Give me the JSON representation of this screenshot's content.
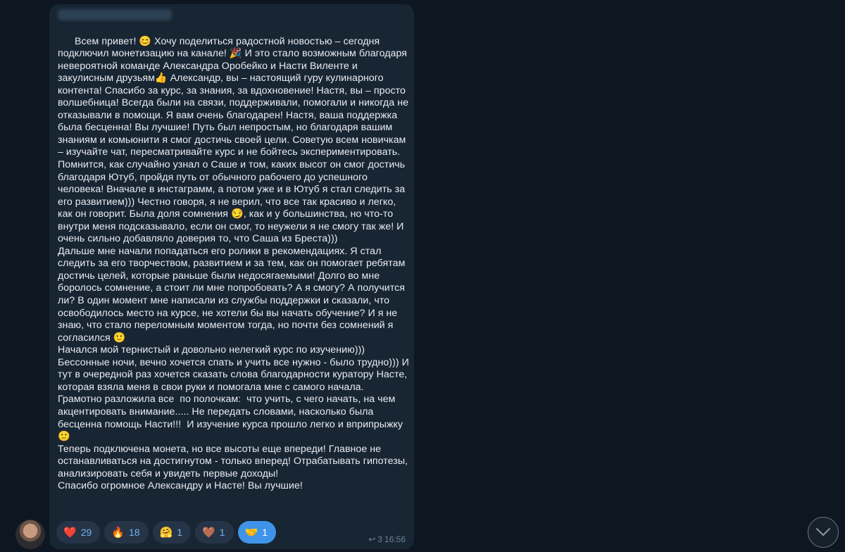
{
  "message": {
    "paragraphs": [
      "Всем привет! 😊 Хочу поделиться радостной новостью – сегодня подключил монетизацию на канале! 🎉 И это стало возможным благодаря невероятной команде Александра Оробейко и Насти Виленте и закулисным друзьям👍 Александр, вы – настоящий гуру кулинарного контента! Спасибо за курс, за знания, за вдохновение! Настя, вы – просто волшебница! Всегда были на связи, поддерживали, помогали и никогда не отказывали в помощи. Я вам очень благодарен! Настя, ваша поддержка была бесценна! Вы лучшие! Путь был непростым, но благодаря вашим знаниям и комьюнити я смог достичь своей цели. Советую всем новичкам – изучайте чат, пересматривайте курс и не бойтесь экспериментировать.",
      "Помнится, как случайно узнал о Саше и том, каких высот он смог достичь благодаря Ютуб, пройдя путь от обычного рабочего до успешного человека! Вначале в инстаграмм, а потом уже и в Ютуб я стал следить за его развитием))) Честно говоря, я не верил, что все так красиво и легко, как он говорит. Была доля сомнения 😏, как и у большинства, но что-то внутри меня подсказывало, если он смог, то неужели я не смогу так же! И очень сильно добавляло доверия то, что Саша из Бреста)))",
      "Дальше мне начали попадаться его ролики в рекомендациях. Я стал следить за его творчеством, развитием и за тем, как он помогает ребятам достичь целей, которые раньше были недосягаемыми! Долго во мне боролось сомнение, а стоит ли мне попробовать? А я смогу? А получится ли? В один момент мне написали из службы поддержки и сказали, что освободилось место на курсе, не хотели бы вы начать обучение? И я не знаю, что стало переломным моментом тогда, но почти без сомнений я согласился 🙂",
      "Начался мой тернистый и довольно нелегкий курс по изучению))) Бессонные ночи, вечно хочется спать и учить все нужно - было трудно))) И тут в очередной раз хочется сказать слова благодарности куратору Насте, которая взяла меня в свои руки и помогала мне с самого начала. Грамотно разложила все  по полочкам:  что учить, с чего начать, на чем акцентировать внимание..... Не передать словами, насколько была бесценна помощь Насти!!!  И изучение курса прошло легко и вприпрыжку🙂",
      "Теперь подключена монета, но все высоты еще впереди! Главное не останавливаться на достигнутом - только вперед! Отрабатывать гипотезы, анализировать себя и увидеть первые доходы!",
      "Спасибо огромное Александру и Насте! Вы лучшие!"
    ],
    "time": "16:56",
    "forward_count": "3"
  },
  "reactions": [
    {
      "emoji": "❤️",
      "count": "29",
      "active": false
    },
    {
      "emoji": "🔥",
      "count": "18",
      "active": false
    },
    {
      "emoji": "🤗",
      "count": "1",
      "active": false
    },
    {
      "emoji": "🤎",
      "count": "1",
      "active": false
    },
    {
      "emoji": "🤝",
      "count": "1",
      "active": true
    }
  ],
  "icons": {
    "forward": "forward-arrow-icon",
    "scroll_down": "chevron-down-icon"
  },
  "colors": {
    "background": "#0e1621",
    "bubble": "#182533",
    "text": "#e8edf2",
    "reaction_bg": "#253447",
    "reaction_active": "#3f94ea",
    "reaction_count": "#72b3ec",
    "meta": "#6d8296"
  }
}
